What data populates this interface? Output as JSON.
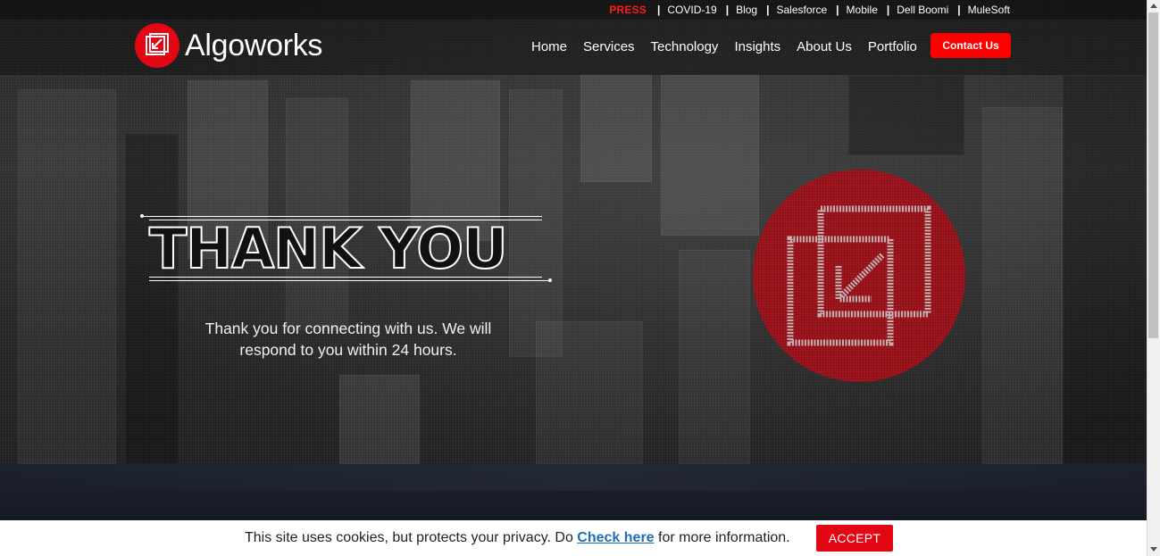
{
  "topbar": {
    "press": "PRESS",
    "links": [
      "COVID-19",
      "Blog",
      "Salesforce",
      "Mobile",
      "Dell Boomi",
      "MuleSoft"
    ]
  },
  "header": {
    "brand": "Algoworks",
    "nav": [
      "Home",
      "Services",
      "Technology",
      "Insights",
      "About Us",
      "Portfolio"
    ],
    "contact_label": "Contact Us"
  },
  "hero": {
    "title": "THANK YOU",
    "message": "Thank you for connecting with us. We will respond to you within 24 hours."
  },
  "cookie": {
    "text_before": "This site uses cookies, but protects your privacy. Do ",
    "link_label": "Check here",
    "text_after": " for more information.",
    "accept_label": "ACCEPT"
  },
  "colors": {
    "brand_red": "#e30613",
    "contact_red": "#ff0000",
    "link_blue": "#1d6fb8"
  }
}
